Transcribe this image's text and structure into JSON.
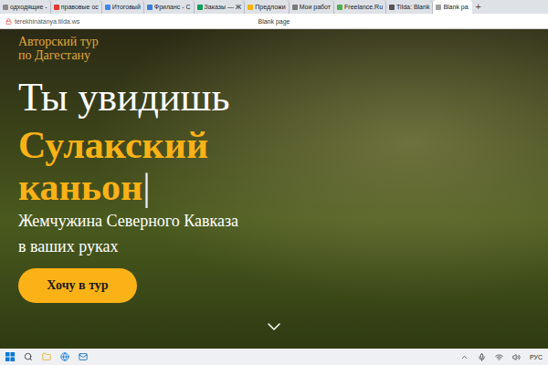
{
  "browser": {
    "tabs": [
      {
        "label": "одходящие -",
        "selected": false,
        "color": "#8a8a8a"
      },
      {
        "label": "правовые ос",
        "selected": false,
        "color": "#e53935"
      },
      {
        "label": "Итоговый",
        "selected": false,
        "color": "#4285f4"
      },
      {
        "label": "Фриланс - С",
        "selected": false,
        "color": "#3b7ddd"
      },
      {
        "label": "Заказы — Ж",
        "selected": false,
        "color": "#0f9d58"
      },
      {
        "label": "Предложи",
        "selected": false,
        "color": "#f4b400"
      },
      {
        "label": "Мои работ",
        "selected": false,
        "color": "#7a7a7a"
      },
      {
        "label": "Freelance.Ru",
        "selected": false,
        "color": "#4caf50"
      },
      {
        "label": "Tilda: Blank",
        "selected": false,
        "color": "#555555"
      },
      {
        "label": "Blank pa",
        "selected": true,
        "color": "#9e9e9e"
      }
    ],
    "new_tab": "+",
    "address": "terekhinatanya.tilda.ws",
    "page_title": "Blank page"
  },
  "hero": {
    "eyebrow": [
      "Авторский тур",
      "по Дагестану"
    ],
    "title": "Ты увидишь",
    "highlight": [
      "Сулакский",
      "каньон"
    ],
    "cursor": "|",
    "subtitle": [
      "Жемчужина Северного Кавказа",
      "в ваших руках"
    ],
    "button": "Хочу в тур"
  },
  "taskbar": {
    "language": "РУС"
  }
}
